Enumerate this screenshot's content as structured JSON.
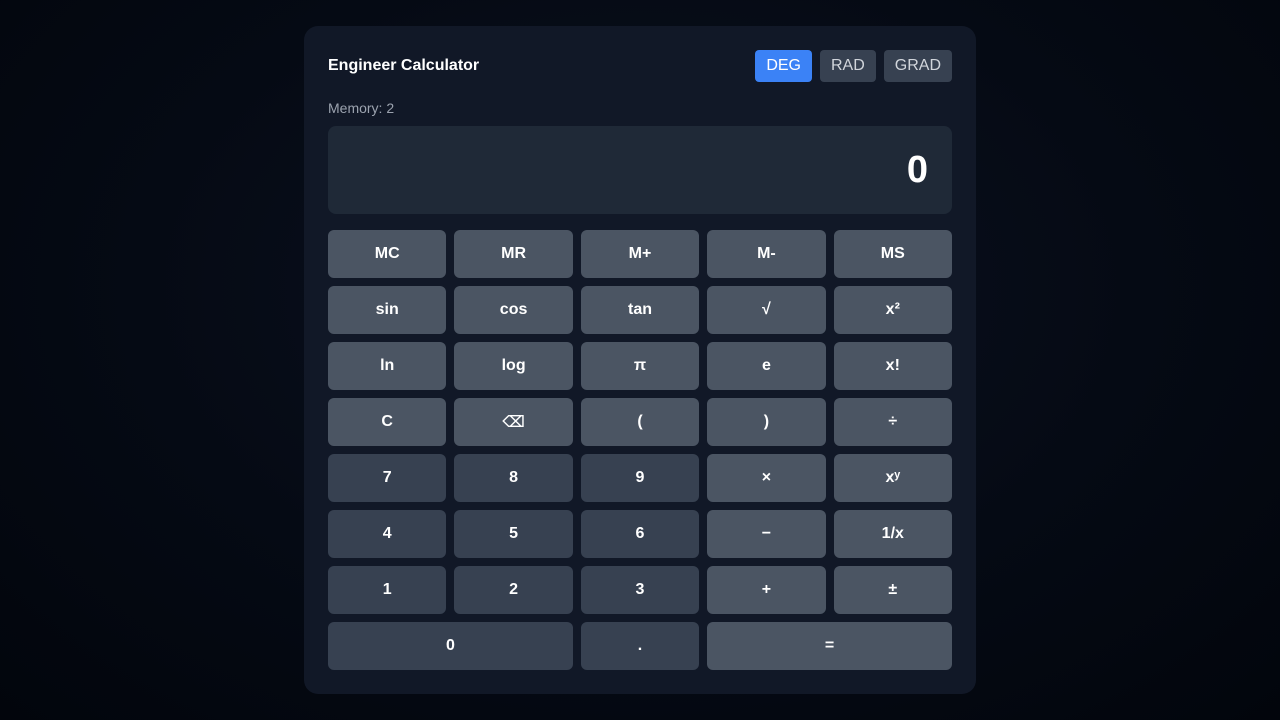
{
  "calculator": {
    "title": "Engineer Calculator",
    "modes": [
      {
        "label": "DEG",
        "active": true
      },
      {
        "label": "RAD",
        "active": false
      },
      {
        "label": "GRAD",
        "active": false
      }
    ],
    "memory_text": "Memory: 2",
    "display_value": "0",
    "keys": {
      "mc": "MC",
      "mr": "MR",
      "mplus": "M+",
      "mminus": "M-",
      "ms": "MS",
      "sin": "sin",
      "cos": "cos",
      "tan": "tan",
      "sqrt": "√",
      "square": "x²",
      "ln": "ln",
      "log": "log",
      "pi": "π",
      "e": "e",
      "factorial": "x!",
      "clear": "C",
      "backspace": "⌫",
      "lparen": "(",
      "rparen": ")",
      "divide": "÷",
      "seven": "7",
      "eight": "8",
      "nine": "9",
      "multiply": "×",
      "power": "xʸ",
      "four": "4",
      "five": "5",
      "six": "6",
      "minus": "−",
      "reciprocal": "1/x",
      "one": "1",
      "two": "2",
      "three": "3",
      "plus": "+",
      "negate": "±",
      "zero": "0",
      "decimal": ".",
      "equals": "="
    }
  },
  "colors": {
    "accent": "#3b82f6",
    "panel": "#111827",
    "display": "#1f2937",
    "digit_key": "#374151",
    "function_key": "#4b5563"
  }
}
